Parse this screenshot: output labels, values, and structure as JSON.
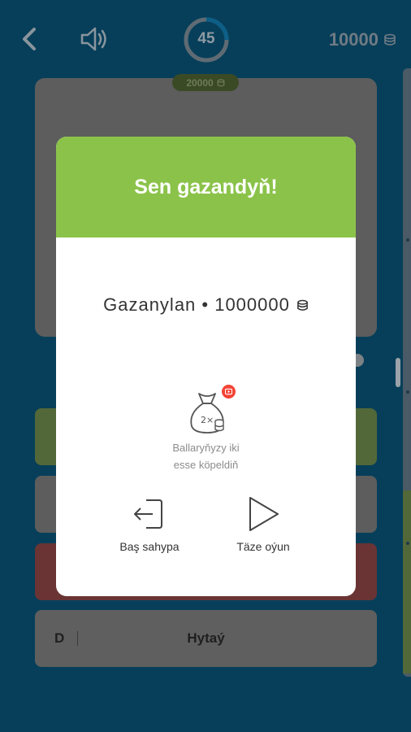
{
  "topbar": {
    "timer": "45",
    "timer_progress": 0.25,
    "coins": "10000",
    "prize": "20000"
  },
  "answers": {
    "d": {
      "letter": "D",
      "text": "Hytaý"
    }
  },
  "modal": {
    "title": "Sen gazandyň!",
    "earned": "Gazanylan • 1000000",
    "double_label_line1": "Ballaryňyzy iki",
    "double_label_line2": "esse köpeldiň",
    "double_badge": "2×",
    "home_label": "Baş sahypa",
    "new_game_label": "Täze oýun"
  },
  "colors": {
    "background": "#073f5a",
    "header_green": "#8bc34a",
    "badge_red": "#f44336"
  },
  "icons": {
    "back": "chevron-left-icon",
    "sound": "speaker-icon",
    "coin": "coin-stack-icon",
    "bag": "money-bag-icon",
    "video": "video-play-icon",
    "home": "exit-door-icon",
    "play": "play-icon"
  }
}
